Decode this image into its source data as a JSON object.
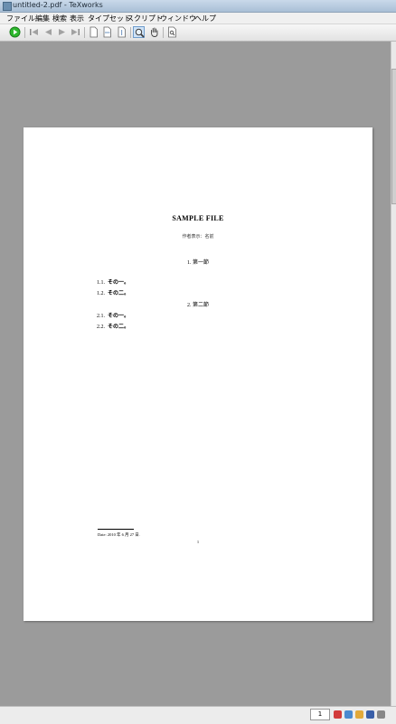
{
  "window": {
    "title": "untitled-2.pdf - TeXworks"
  },
  "menu": [
    "ファイル",
    "編集",
    "検索",
    "表示",
    "タイプセット",
    "スクリプト",
    "ウィンドウ",
    "ヘルプ"
  ],
  "toolbar": {
    "icons": [
      "typeset-icon",
      "first-page-icon",
      "previous-page-icon",
      "next-page-icon",
      "last-page-icon",
      "actual-size-icon",
      "fit-width-icon",
      "fit-window-icon",
      "magnify-icon",
      "hand-icon",
      "find-icon"
    ],
    "active": "magnify-icon"
  },
  "document": {
    "title": "SAMPLE FILE",
    "author": "作者表示：名前",
    "sections": [
      {
        "heading": "1.  第一節",
        "subsections": [
          {
            "num": "1.1.",
            "label": "その一。"
          },
          {
            "num": "1.2.",
            "label": "その二。"
          }
        ]
      },
      {
        "heading": "2.  第二節",
        "subsections": [
          {
            "num": "2.1.",
            "label": "その一。"
          },
          {
            "num": "2.2.",
            "label": "その二。"
          }
        ]
      }
    ],
    "footnote": "Date: 2010 年 6 月 27 日.",
    "page_number": "1"
  },
  "status": {
    "page_field": "1"
  },
  "colors": {
    "canvas": "#9b9b9b",
    "page": "#ffffff",
    "typeset_green": "#2db82d"
  }
}
